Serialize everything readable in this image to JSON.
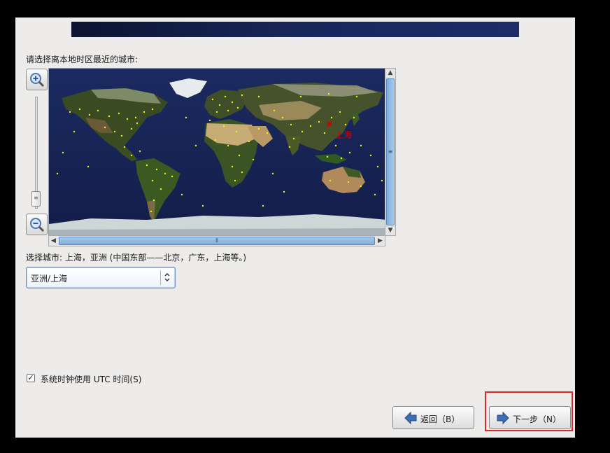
{
  "prompt": "请选择离本地时区最近的城市:",
  "map": {
    "selected_label": "上海",
    "marker_color": "#d40000",
    "dot_color": "#f2f200",
    "vscroll_grip": "≡",
    "hscroll_grip": "⦀",
    "zoom_grip": "≡"
  },
  "selected_city_text": "选择城市: 上海，亚洲 (中国东部——北京，广东，上海等。)",
  "city_select": {
    "value": "亚洲/上海"
  },
  "utc": {
    "checked": true,
    "check_glyph": "✓",
    "label": "系统时钟使用 UTC 时间(S)"
  },
  "buttons": {
    "back": {
      "label": "返回（B）",
      "icon": "arrow-left-icon"
    },
    "next": {
      "label": "下一步（N）",
      "icon": "arrow-right-icon"
    }
  },
  "colors": {
    "banner": "#18275a",
    "highlight": "#d62a2a",
    "arrow_icon": "#3f6fb3",
    "ocean": "#172456"
  }
}
